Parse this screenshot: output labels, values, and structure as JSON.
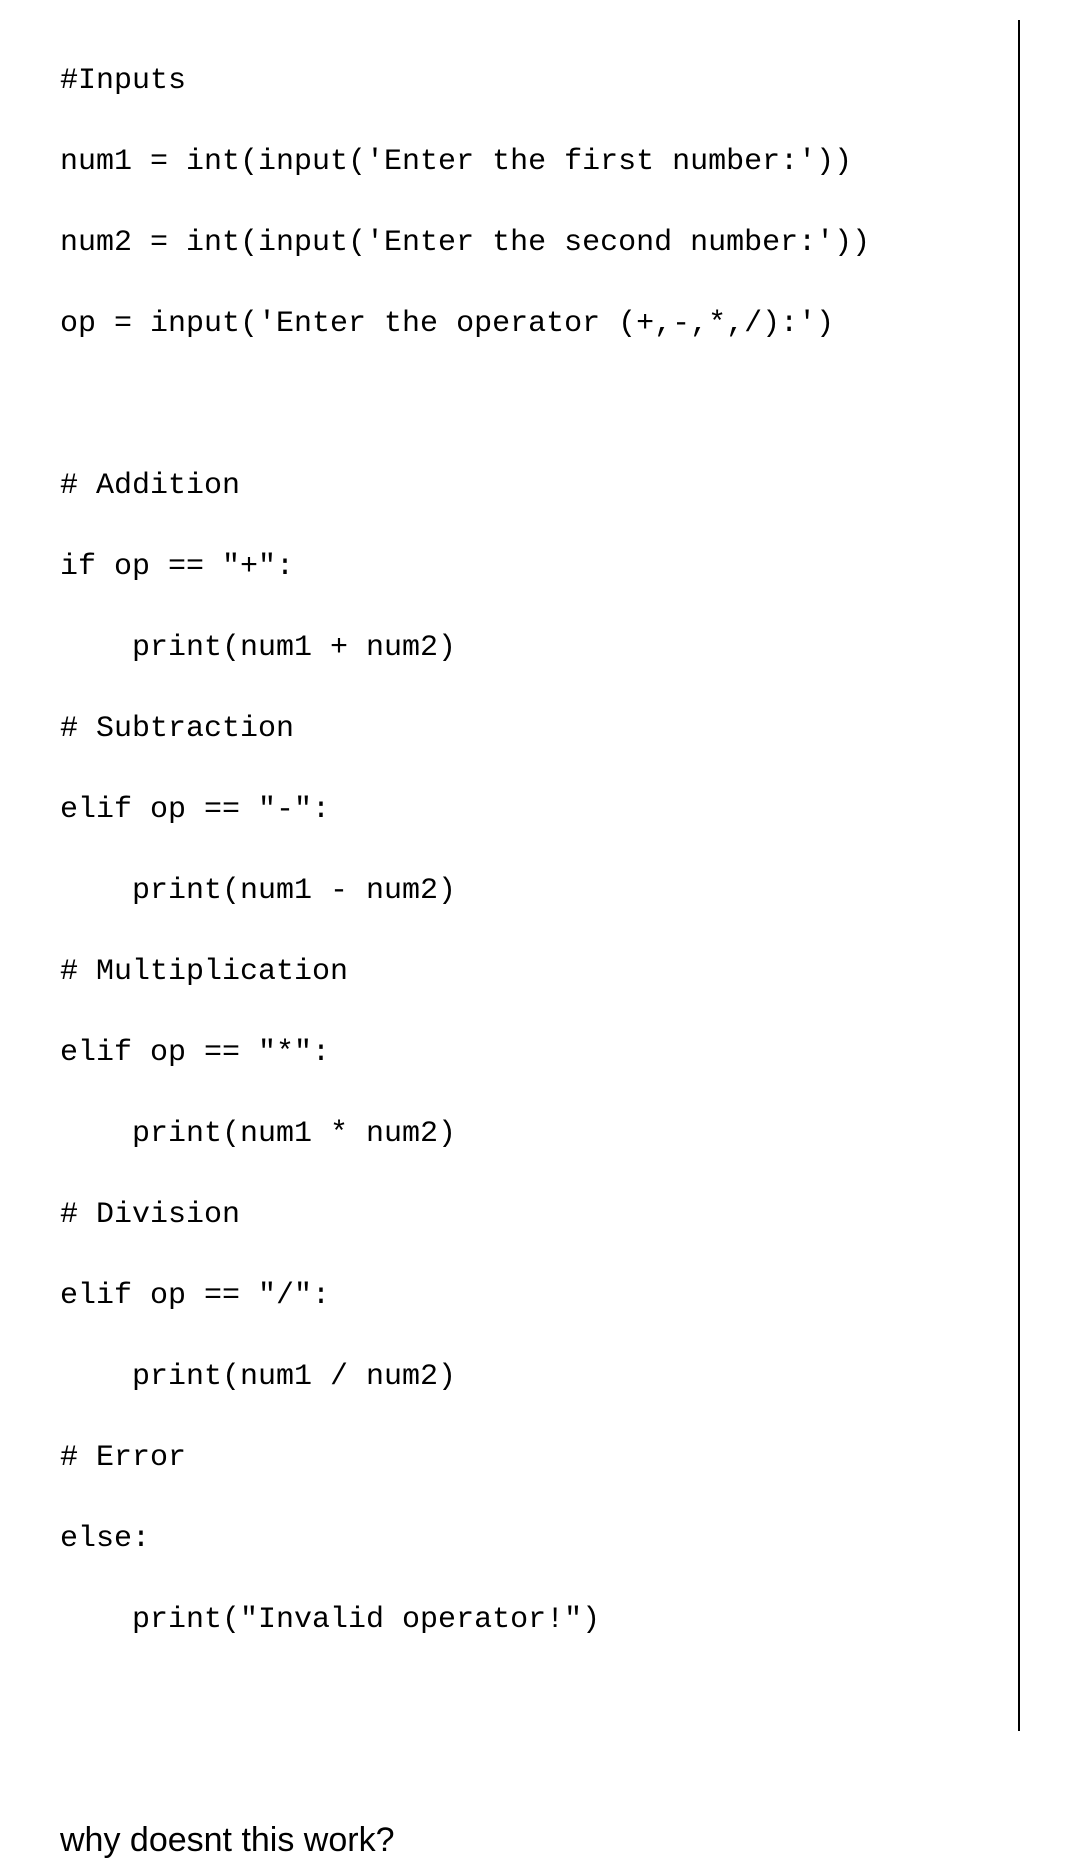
{
  "code": {
    "lines": [
      "#Inputs",
      "num1 = int(input('Enter the first number:'))",
      "num2 = int(input('Enter the second number:'))",
      "op = input('Enter the operator (+,-,*,/):')",
      "",
      "# Addition",
      "if op == \"+\":",
      "    print(num1 + num2)",
      "# Subtraction",
      "elif op == \"-\":",
      "    print(num1 - num2)",
      "# Multiplication",
      "elif op == \"*\":",
      "    print(num1 * num2)",
      "# Division",
      "elif op == \"/\":",
      "    print(num1 / num2)",
      "# Error",
      "else:",
      "    print(\"Invalid operator!\")"
    ]
  },
  "question": "why doesnt this work?"
}
